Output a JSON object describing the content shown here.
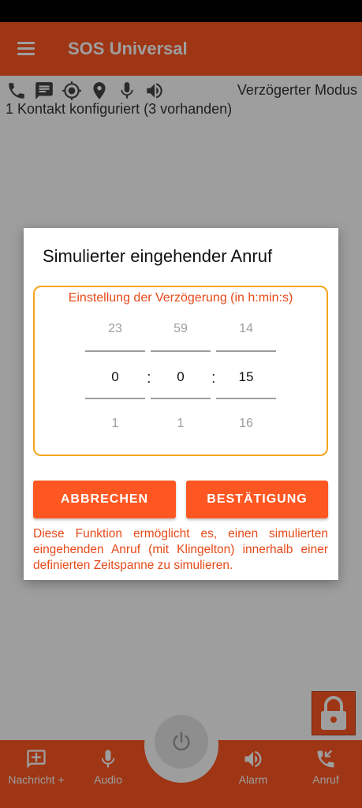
{
  "app": {
    "title": "SOS Universal"
  },
  "header": {
    "mode_label": "Verzögerter Modus",
    "contact_status": "1 Kontakt konfiguriert (3 vorhanden)",
    "icons": [
      "phone-icon",
      "message-icon",
      "gps-target-icon",
      "location-pin-icon",
      "microphone-icon",
      "speaker-icon"
    ]
  },
  "dialog": {
    "title": "Simulierter eingehender Anruf",
    "picker_label": "Einstellung der Verzögerung (in h:min:s)",
    "separator": ":",
    "columns": [
      {
        "name": "hours",
        "prev": "23",
        "value": "0",
        "next": "1"
      },
      {
        "name": "minutes",
        "prev": "59",
        "value": "0",
        "next": "1"
      },
      {
        "name": "seconds",
        "prev": "14",
        "value": "15",
        "next": "16"
      }
    ],
    "cancel_label": "ABBRECHEN",
    "confirm_label": "BESTÄTIGUNG",
    "description": "Diese Funktion ermöglicht es, einen simulierten eingehenden Anruf (mit Klingelton) innerhalb einer definierten Zeitspanne zu simulieren."
  },
  "bottom_nav": {
    "items": [
      {
        "label": "Nachricht +",
        "icon": "add-message-icon"
      },
      {
        "label": "Audio",
        "icon": "microphone-icon"
      },
      {
        "label": "Alarm",
        "icon": "speaker-icon"
      },
      {
        "label": "Anruf",
        "icon": "incoming-call-icon"
      }
    ],
    "center_icon": "power-icon"
  },
  "colors": {
    "primary": "#FF5722",
    "accent_text": "#E64A19",
    "picker_border": "#F3A51A",
    "status_bar": "#000000"
  }
}
